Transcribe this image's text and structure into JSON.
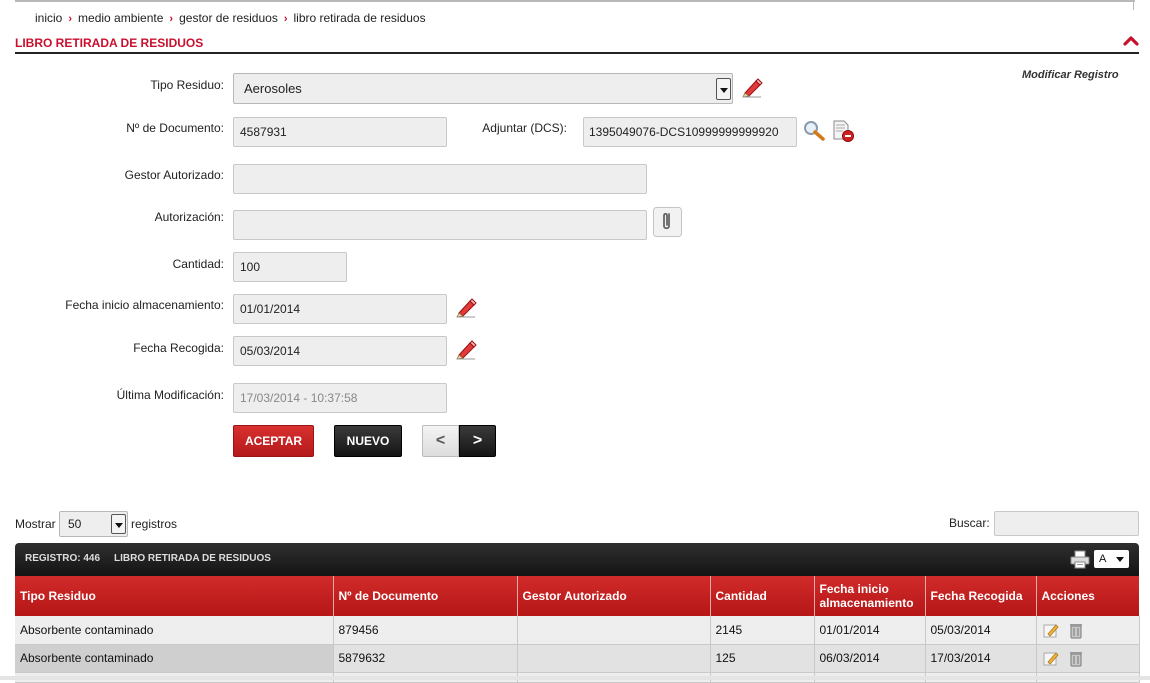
{
  "breadcrumb": [
    {
      "label": "inicio"
    },
    {
      "label": "medio ambiente"
    },
    {
      "label": "gestor de residuos"
    },
    {
      "label": "libro retirada de residuos"
    }
  ],
  "section": {
    "title": "LIBRO RETIRADA DE RESIDUOS",
    "mode": "Modificar Registro"
  },
  "form": {
    "tipo_residuo": {
      "label": "Tipo Residuo:",
      "value": "Aerosoles"
    },
    "num_documento": {
      "label": "Nº de Documento:",
      "value": "4587931"
    },
    "adjuntar": {
      "label": "Adjuntar (DCS):",
      "value": "1395049076-DCS10999999999920"
    },
    "gestor": {
      "label": "Gestor Autorizado:",
      "value": ""
    },
    "autorizacion": {
      "label": "Autorización:",
      "value": ""
    },
    "cantidad": {
      "label": "Cantidad:",
      "value": "100"
    },
    "fecha_inicio": {
      "label": "Fecha inicio almacenamiento:",
      "value": "01/01/2014"
    },
    "fecha_recogida": {
      "label": "Fecha Recogida:",
      "value": "05/03/2014"
    },
    "ultima_mod": {
      "label": "Última Modificación:",
      "value": "17/03/2014 - 10:37:58"
    }
  },
  "buttons": {
    "accept": "ACEPTAR",
    "new": "NUEVO",
    "prev": "<",
    "next": ">"
  },
  "list_controls": {
    "show_label": "Mostrar",
    "page_size": "50",
    "records_label": "registros",
    "search_label": "Buscar:",
    "search_value": ""
  },
  "grid": {
    "registro": "REGISTRO: 446",
    "title": "LIBRO RETIRADA DE RESIDUOS",
    "font_size": "A",
    "columns": [
      "Tipo Residuo",
      "Nº de Documento",
      "Gestor Autorizado",
      "Cantidad",
      "Fecha inicio almacenamiento",
      "Fecha Recogida",
      "Acciones"
    ],
    "rows": [
      [
        "Absorbente contaminado",
        "879456",
        "",
        "2145",
        "01/01/2014",
        "05/03/2014"
      ],
      [
        "Absorbente contaminado",
        "5879632",
        "",
        "125",
        "06/03/2014",
        "17/03/2014"
      ]
    ]
  },
  "icons": {
    "edit": "eraser-pencil-icon",
    "search": "magnifier-icon",
    "remove_file": "delete-document-icon",
    "attach": "paperclip-icon",
    "print": "printer-icon",
    "row_edit": "edit-row-icon",
    "row_delete": "trash-icon",
    "collapse": "chevron-up-icon"
  },
  "colors": {
    "accent": "#c8102e",
    "dark": "#1c1c1c",
    "field_bg": "#eeeeee"
  }
}
